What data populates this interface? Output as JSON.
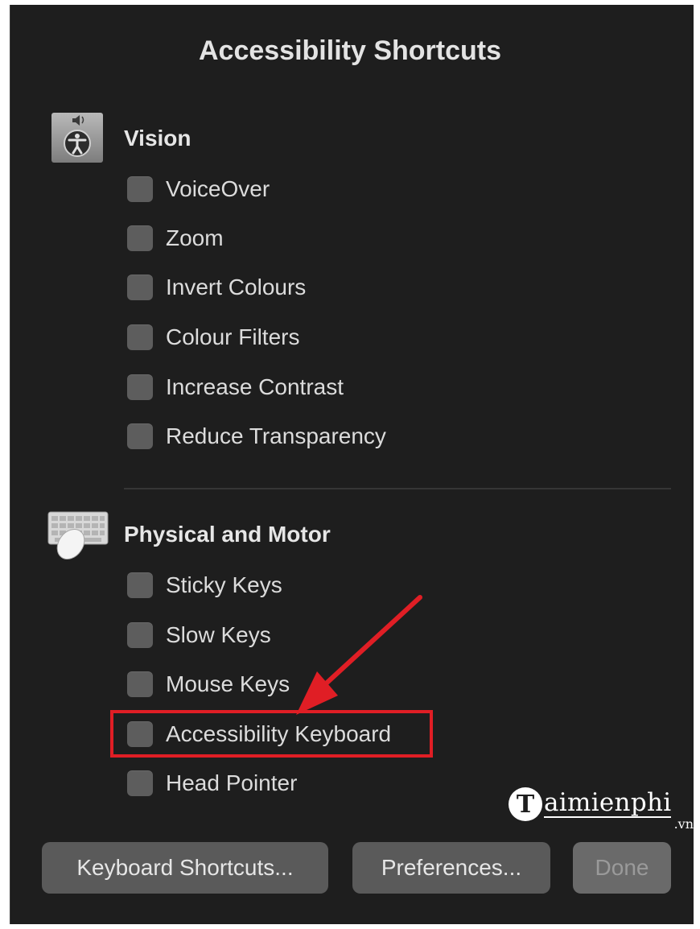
{
  "dialog": {
    "title": "Accessibility Shortcuts"
  },
  "sections": {
    "vision": {
      "title": "Vision",
      "icon": "accessibility-person-icon",
      "items": [
        "VoiceOver",
        "Zoom",
        "Invert Colours",
        "Colour Filters",
        "Increase Contrast",
        "Reduce Transparency"
      ]
    },
    "motor": {
      "title": "Physical and Motor",
      "icon": "keyboard-mouse-icon",
      "items": [
        "Sticky Keys",
        "Slow Keys",
        "Mouse Keys",
        "Accessibility Keyboard",
        "Head Pointer"
      ]
    }
  },
  "buttons": {
    "keyboard_shortcuts": "Keyboard Shortcuts...",
    "preferences": "Preferences...",
    "done": "Done"
  },
  "watermark": {
    "letter": "T",
    "name": "aimienphi",
    "suffix": ".vn"
  },
  "colors": {
    "panel_bg": "#1e1e1e",
    "highlight": "#e01e25"
  }
}
